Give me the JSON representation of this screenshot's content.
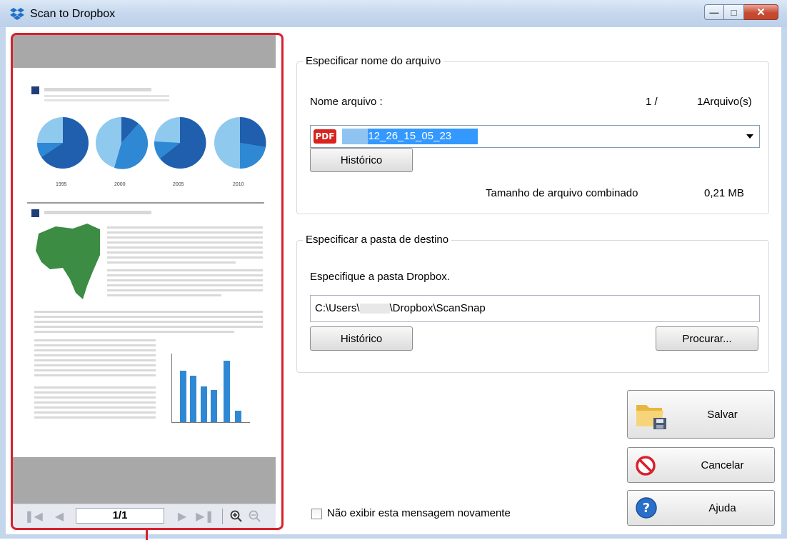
{
  "window": {
    "title": "Scan to Dropbox"
  },
  "preview": {
    "page_indicator": "1/1",
    "document_years": [
      "1995",
      "2000",
      "2005",
      "2010"
    ]
  },
  "filename_group": {
    "title": "Especificar nome do arquivo",
    "label": "Nome arquivo :",
    "label_accesskey": "q",
    "count_current": "1  /",
    "count_total": "1Arquivo(s)",
    "file_icon": "PDF",
    "filename_value": "_12_26_15_05_23",
    "history_button": "Histórico",
    "size_label": "Tamanho de arquivo combinado",
    "size_value": "0,21 MB"
  },
  "destination_group": {
    "title": "Especificar a pasta de destino",
    "instruction": "Especifique a pasta Dropbox.",
    "path_prefix": "C:\\Users\\",
    "path_suffix": "\\Dropbox\\ScanSnap",
    "history_button": "Histórico",
    "browse_button": "Procurar..."
  },
  "actions": {
    "save": "Salvar",
    "cancel": "Cancelar",
    "help": "Ajuda"
  },
  "dont_show_again": "Não exibir esta mensagem novamente",
  "colors": {
    "highlight_border": "#d9202c",
    "selection": "#3399ff",
    "pdf_badge": "#d8231e"
  }
}
